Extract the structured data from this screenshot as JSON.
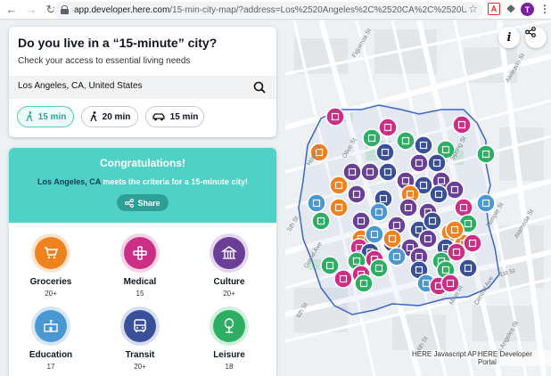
{
  "browser": {
    "url_host": "app.developer.here.com",
    "url_path": "/15-min-city-map/?address=Los%2520Angeles%2C%2520CA%2C%2520United%2520St...",
    "avatar_letter": "T"
  },
  "panel": {
    "title": "Do you live in a “15-minute” city?",
    "subtitle": "Check your access to essential living needs",
    "search_value": "Los Angeles, CA, United States",
    "modes": [
      {
        "label": "15 min",
        "kind": "walk",
        "active": true
      },
      {
        "label": "20 min",
        "kind": "walk",
        "active": false
      },
      {
        "label": "15 min",
        "kind": "car",
        "active": false
      }
    ]
  },
  "result": {
    "heading": "Congratulations!",
    "city": "Los Angeles, CA",
    "criteria_text": " meets the criteria for a 15-minute city!",
    "share_label": "Share",
    "categories": [
      {
        "name": "Groceries",
        "count": "20+",
        "icon": "cart-icon",
        "color": "#f0811f",
        "ring": "#fde3cc"
      },
      {
        "name": "Medical",
        "count": "15",
        "icon": "medical-cross-icon",
        "color": "#cc2e85",
        "ring": "#f6d2e4"
      },
      {
        "name": "Culture",
        "count": "20+",
        "icon": "museum-icon",
        "color": "#6b3f97",
        "ring": "#e3d6ee"
      },
      {
        "name": "Education",
        "count": "17",
        "icon": "school-icon",
        "color": "#4a98d3",
        "ring": "#d5e6f5"
      },
      {
        "name": "Transit",
        "count": "20+",
        "icon": "bus-icon",
        "color": "#3a4f9a",
        "ring": "#d7dcee"
      },
      {
        "name": "Leisure",
        "count": "18",
        "icon": "tree-icon",
        "color": "#2eae63",
        "ring": "#d1efdd"
      }
    ]
  },
  "map": {
    "attribution_api": "HERE Javascript API",
    "attribution_portal": "HERE Developer Portal",
    "streets": [
      "Figueroa St",
      "Spring St",
      "Main St",
      "5th St",
      "6th St",
      "4th St",
      "Olive St",
      "Hope St",
      "Grand Ave",
      "Alameda St",
      "Temple St",
      "Central Ave",
      "Los Angeles St",
      "Alvarado St",
      "1st St"
    ]
  },
  "colors": {
    "teal": "#4fd1c5",
    "boundary": "#3c66c9"
  }
}
